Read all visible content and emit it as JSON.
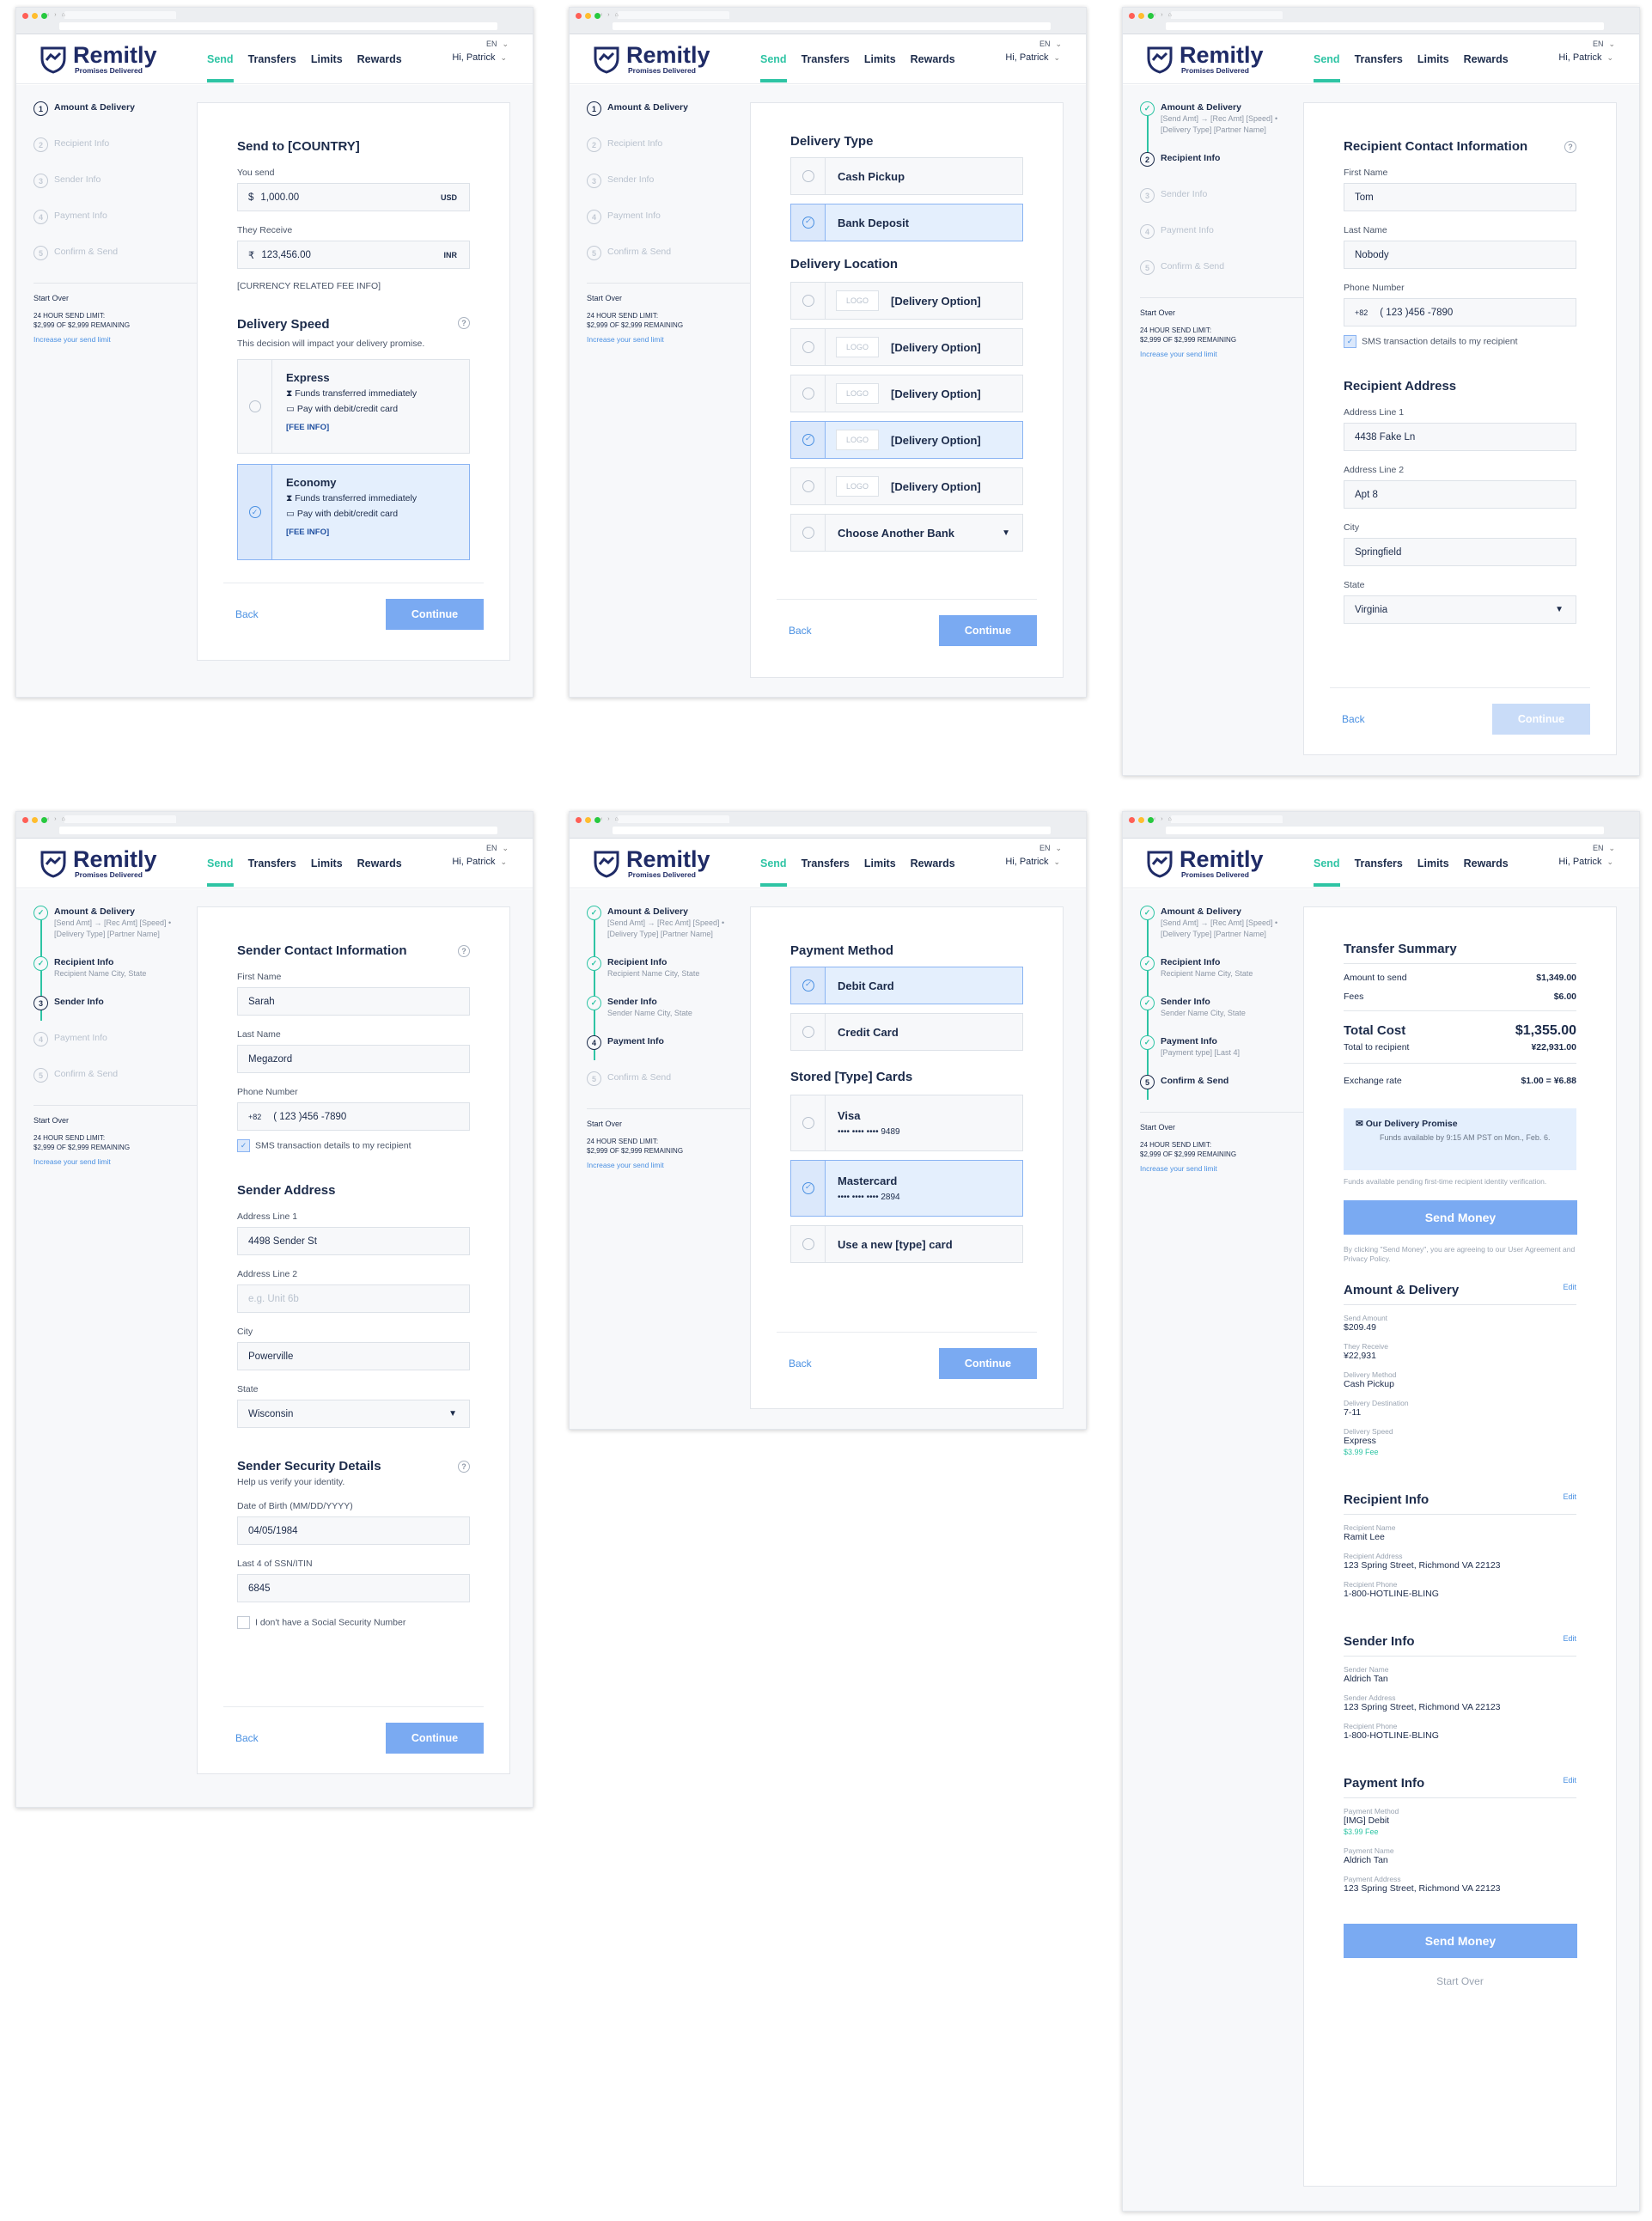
{
  "brand": {
    "name": "Remitly",
    "tagline": "Promises Delivered"
  },
  "nav": {
    "send": "Send",
    "transfers": "Transfers",
    "limits": "Limits",
    "rewards": "Rewards",
    "lang": "EN",
    "user": "Hi, Patrick"
  },
  "colors": {
    "accent": "#2ec4a4",
    "primary": "#7aaaf2",
    "navy": "#1f2b66"
  },
  "sidebar": {
    "steps": [
      "Amount & Delivery",
      "Recipient Info",
      "Sender Info",
      "Payment Info",
      "Confirm & Send"
    ],
    "start_over": "Start Over",
    "limit_label": "24 HOUR SEND LIMIT:",
    "limit_value": "$2,999 OF $2,999 REMAINING",
    "increase": "Increase your send limit",
    "amount_sub": "[Send Amt] → [Rec Amt] [Speed] • [Delivery Type] [Partner Name]",
    "recipient_sub": "Recipient Name City, State",
    "sender_sub": "Sender Name City, State",
    "payment_sub": "[Payment type] [Last 4]"
  },
  "buttons": {
    "back": "Back",
    "continue": "Continue"
  },
  "s1": {
    "title": "Send to [COUNTRY]",
    "you_send_label": "You send",
    "you_send_symbol": "$",
    "you_send": "1,000.00",
    "you_send_unit": "USD",
    "they_receive_label": "They Receive",
    "they_receive_symbol": "₹",
    "they_receive": "123,456.00",
    "they_receive_unit": "INR",
    "fee_info": "[CURRENCY RELATED FEE INFO]",
    "speed_title": "Delivery Speed",
    "speed_note": "This decision will impact your delivery promise.",
    "express": "Express",
    "economy": "Economy",
    "feat1": "Funds transferred immediately",
    "feat2": "Pay with debit/credit card",
    "fee": "[FEE INFO]"
  },
  "s2": {
    "type_title": "Delivery Type",
    "cash": "Cash Pickup",
    "bank": "Bank Deposit",
    "loc_title": "Delivery Location",
    "logo": "LOGO",
    "option": "[Delivery Option]",
    "another": "Choose Another Bank"
  },
  "s3": {
    "title": "Recipient Contact Information",
    "first_label": "First Name",
    "first": "Tom",
    "last_label": "Last Name",
    "last": "Nobody",
    "phone_label": "Phone Number",
    "cc": "+82",
    "phone": "( 123 )456 -7890",
    "sms": "SMS transaction details to my recipient",
    "addr_title": "Recipient Address",
    "a1_label": "Address Line 1",
    "a1": "4438 Fake Ln",
    "a2_label": "Address Line 2",
    "a2": "Apt 8",
    "city_label": "City",
    "city": "Springfield",
    "state_label": "State",
    "state": "Virginia"
  },
  "s4": {
    "title": "Sender Contact Information",
    "first_label": "First Name",
    "first": "Sarah",
    "last_label": "Last Name",
    "last": "Megazord",
    "phone_label": "Phone Number",
    "cc": "+82",
    "phone": "( 123 )456 -7890",
    "sms": "SMS transaction details to my recipient",
    "addr_title": "Sender Address",
    "a1_label": "Address Line 1",
    "a1": "4498 Sender St",
    "a2_label": "Address Line 2",
    "a2_ph": "e.g. Unit 6b",
    "city_label": "City",
    "city": "Powerville",
    "state_label": "State",
    "state": "Wisconsin",
    "sec_title": "Sender Security Details",
    "sec_sub": "Help us verify your identity.",
    "dob_label": "Date of Birth (MM/DD/YYYY)",
    "dob": "04/05/1984",
    "ssn_label": "Last 4 of SSN/ITIN",
    "ssn": "6845",
    "no_ssn": "I don't have a Social Security Number"
  },
  "s5": {
    "pm_title": "Payment Method",
    "debit": "Debit Card",
    "credit": "Credit Card",
    "stored_title": "Stored [Type] Cards",
    "visa": "Visa",
    "visa_num": "•••• •••• •••• 9489",
    "mc": "Mastercard",
    "mc_num": "•••• •••• •••• 2894",
    "new": "Use a new [type] card"
  },
  "s6": {
    "title": "Transfer Summary",
    "amt_label": "Amount to send",
    "amt": "$1,349.00",
    "fees_label": "Fees",
    "fees": "$6.00",
    "total_label": "Total Cost",
    "total": "$1,355.00",
    "torec_label": "Total to recipient",
    "torec": "¥22,931.00",
    "rate_label": "Exchange rate",
    "rate": "$1.00 = ¥6.88",
    "promise_title": "Our Delivery Promise",
    "promise_text": "Funds available by 9:15 AM PST on Mon., Feb. 6.",
    "pending": "Funds available pending first-time recipient identity verification.",
    "send": "Send Money",
    "agree": "By clicking \"Send Money\", you are agreeing to our User Agreement and Privacy Policy.",
    "edit": "Edit",
    "ad_title": "Amount & Delivery",
    "ad": [
      [
        "Send Amount",
        "$209.49"
      ],
      [
        "They Receive",
        "¥22,931"
      ],
      [
        "Delivery Method",
        "Cash Pickup"
      ],
      [
        "Delivery Destination",
        "7-11"
      ],
      [
        "Delivery Speed",
        "Express"
      ]
    ],
    "ad_fee": "$3.99 Fee",
    "ri_title": "Recipient Info",
    "ri": [
      [
        "Recipient Name",
        "Ramit Lee"
      ],
      [
        "Recipient Address",
        "123 Spring Street, Richmond VA 22123"
      ],
      [
        "Recipient Phone",
        "1-800-HOTLINE-BLING"
      ]
    ],
    "si_title": "Sender Info",
    "si": [
      [
        "Sender Name",
        "Aldrich Tan"
      ],
      [
        "Sender Address",
        "123 Spring Street, Richmond VA 22123"
      ],
      [
        "Recipient Phone",
        "1-800-HOTLINE-BLING"
      ]
    ],
    "pi_title": "Payment Info",
    "pi": [
      [
        "Payment Method",
        "[IMG] Debit"
      ],
      [
        "Payment Name",
        "Aldrich Tan"
      ],
      [
        "Payment Address",
        "123 Spring Street, Richmond VA 22123"
      ]
    ],
    "pi_fee": "$3.99 Fee",
    "start_over": "Start Over"
  }
}
